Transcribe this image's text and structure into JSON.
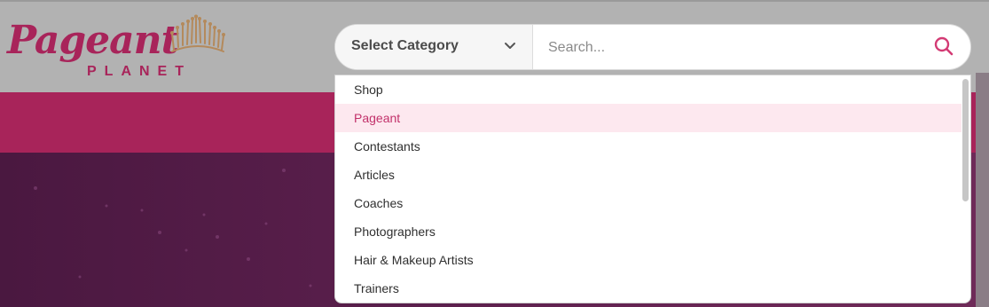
{
  "brand": {
    "name": "Pageant",
    "sub": "PLANET",
    "primary_color": "#a8245a",
    "crown_color": "#b48a5c"
  },
  "search": {
    "category_label": "Select Category",
    "placeholder": "Search...",
    "icon": "search-icon",
    "accent_color": "#d33b74"
  },
  "dropdown": {
    "options": [
      "Shop",
      "Pageant",
      "Contestants",
      "Articles",
      "Coaches",
      "Photographers",
      "Hair & Makeup Artists",
      "Trainers"
    ],
    "highlighted_index": 1,
    "highlight_color": "#fde8ef"
  }
}
